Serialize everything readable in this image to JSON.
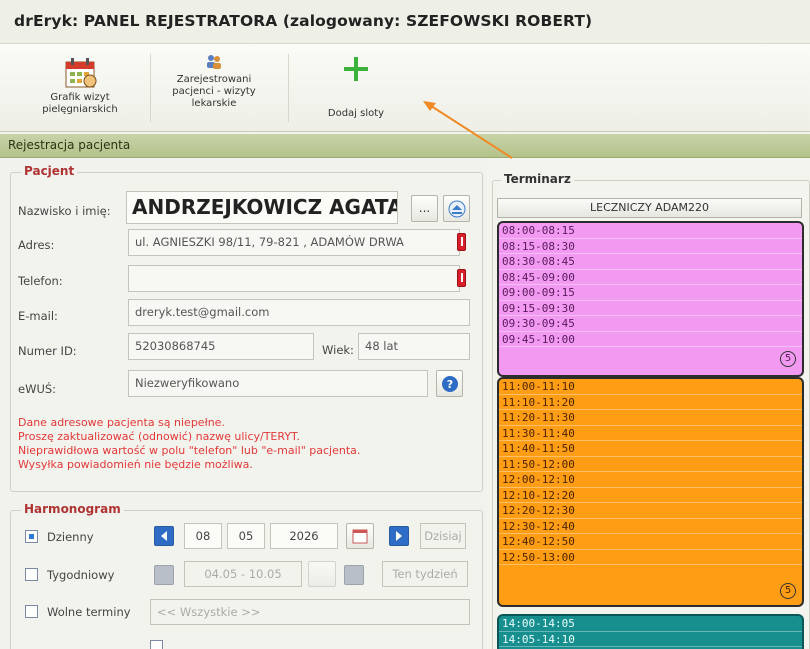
{
  "window": {
    "title": "drEryk: PANEL REJESTRATORA (zalogowany: SZEFOWSKI ROBERT)"
  },
  "ribbon": {
    "btn1": "Grafik wizyt pielęgniarskich",
    "btn2": "Zarejestrowani pacjenci - wizyty lekarskie",
    "btn3": "Dodaj sloty"
  },
  "section": {
    "title": "Rejestracja pacjenta"
  },
  "patient": {
    "legend": "Pacjent",
    "name_label": "Nazwisko i imię:",
    "name_value": "ANDRZEJKOWICZ AGATA",
    "ellipsis": "...",
    "address_label": "Adres:",
    "address_value": "ul. AGNIESZKI 98/11, 79-821 , ADAMÓW DRWA",
    "phone_label": "Telefon:",
    "phone_value": "",
    "email_label": "E-mail:",
    "email_value": "dreryk.test@gmail.com",
    "id_label": "Numer ID:",
    "id_value": "52030868745",
    "age_label": "Wiek:",
    "age_value": "48 lat",
    "ewus_label": "eWUŚ:",
    "ewus_value": "Niezweryfikowano",
    "warnings": [
      "Dane adresowe pacjenta są niepełne.",
      "Proszę zaktualizować (odnowić) nazwę ulicy/TERYT.",
      "Nieprawidłowa wartość w polu \"telefon\" lub \"e-mail\" pacjenta.",
      "Wysyłka powiadomień nie będzie możliwa."
    ]
  },
  "schedule": {
    "legend": "Harmonogram",
    "daily": "Dzienny",
    "weekly": "Tygodniowy",
    "free": "Wolne terminy",
    "day": "08",
    "month": "05",
    "year": "2026",
    "today_btn": "Dzisiaj",
    "week_range": "04.05 - 10.05",
    "this_week_btn": "Ten tydzień",
    "free_select": "<< Wszystkie >>"
  },
  "calendar": {
    "legend": "Terminarz",
    "column": "LECZNICZY ADAM220",
    "block1": [
      "08:00-08:15",
      "08:15-08:30",
      "08:30-08:45",
      "08:45-09:00",
      "09:00-09:15",
      "09:15-09:30",
      "09:30-09:45",
      "09:45-10:00"
    ],
    "block2": [
      "11:00-11:10",
      "11:10-11:20",
      "11:20-11:30",
      "11:30-11:40",
      "11:40-11:50",
      "11:50-12:00",
      "12:00-12:10",
      "12:10-12:20",
      "12:20-12:30",
      "12:30-12:40",
      "12:40-12:50",
      "12:50-13:00"
    ],
    "block3": [
      "14:00-14:05",
      "14:05-14:10"
    ],
    "badge": "5",
    "colors": {
      "block1": "#f29af2",
      "block2": "#ff9d14",
      "block3": "#178f8f"
    }
  }
}
